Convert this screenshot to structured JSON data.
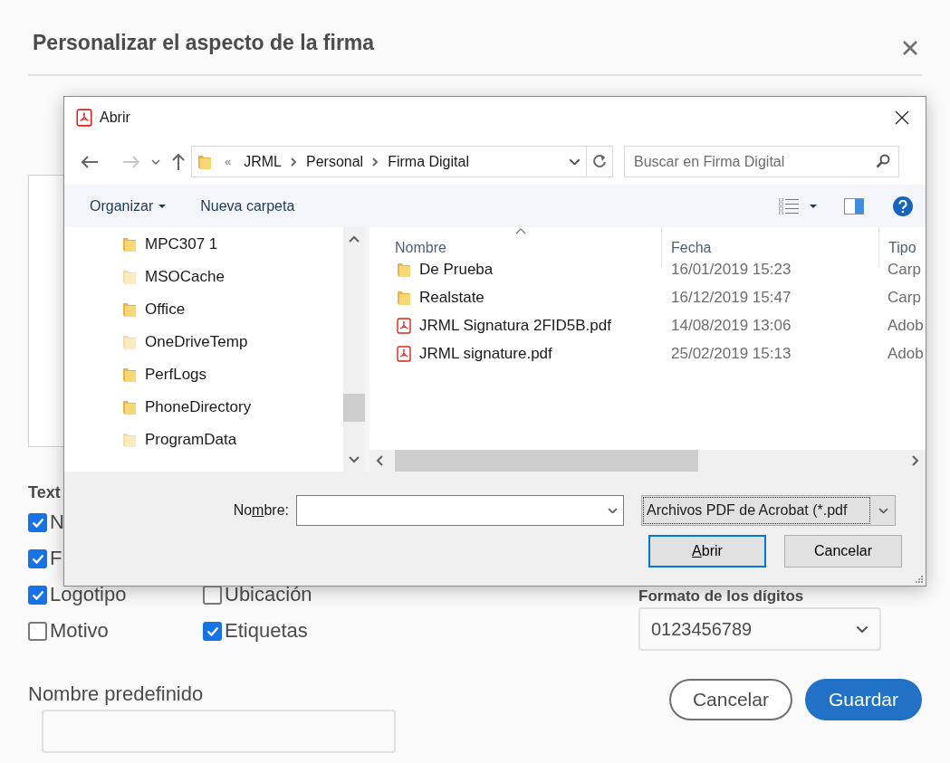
{
  "signature_dialog": {
    "title": "Personalizar el aspecto de la firma",
    "text_section": {
      "heading": "Text",
      "rows": [
        {
          "options": [
            {
              "label": "N",
              "checked": true
            }
          ]
        },
        {
          "options": [
            {
              "label": "F",
              "checked": true
            }
          ]
        },
        {
          "options": [
            {
              "label": "Logotipo",
              "checked": true
            },
            {
              "label": "Ubicación",
              "checked": false
            }
          ]
        },
        {
          "options": [
            {
              "label": "Motivo",
              "checked": false
            },
            {
              "label": "Etiquetas",
              "checked": true
            }
          ]
        }
      ]
    },
    "digits_format": {
      "label": "Formato de los dígitos",
      "value": "0123456789"
    },
    "default_name": {
      "label": "Nombre predefinido"
    },
    "buttons": [
      {
        "label": "Cancelar",
        "kind": "secondary"
      },
      {
        "label": "Guardar",
        "kind": "primary"
      }
    ]
  },
  "open_dialog": {
    "title": "Abrir",
    "breadcrumb": {
      "overflow": "«",
      "segments": [
        "JRML",
        "Personal",
        "Firma Digital"
      ]
    },
    "search": {
      "placeholder": "Buscar en Firma Digital"
    },
    "toolbar": [
      {
        "label": "Organizar",
        "dropdown": true
      },
      {
        "label": "Nueva carpeta",
        "dropdown": false
      }
    ],
    "tree": [
      {
        "name": "MPC307 1",
        "hidden": false
      },
      {
        "name": "MSOCache",
        "hidden": true
      },
      {
        "name": "Office",
        "hidden": false
      },
      {
        "name": "OneDriveTemp",
        "hidden": true
      },
      {
        "name": "PerfLogs",
        "hidden": false
      },
      {
        "name": "PhoneDirectory",
        "hidden": false
      },
      {
        "name": "ProgramData",
        "hidden": true
      }
    ],
    "columns": [
      {
        "label": "Nombre",
        "sorted": true
      },
      {
        "label": "Fecha",
        "sorted": false
      },
      {
        "label": "Tipo",
        "sorted": false
      }
    ],
    "files": [
      {
        "name": "De Prueba",
        "kind": "folder",
        "date": "16/01/2019 15:23",
        "type": "Carp"
      },
      {
        "name": "Realstate",
        "kind": "folder",
        "date": "16/12/2019 15:47",
        "type": "Carp"
      },
      {
        "name": "JRML Signatura 2FID5B.pdf",
        "kind": "pdf",
        "date": "14/08/2019 13:06",
        "type": "Adob"
      },
      {
        "name": "JRML signature.pdf",
        "kind": "pdf",
        "date": "25/02/2019 15:13",
        "type": "Adob"
      }
    ],
    "filename": {
      "label": {
        "before": "No",
        "key": "m",
        "after": "bre:"
      }
    },
    "filter": "Archivos PDF de Acrobat (*.pdf",
    "buttons": [
      {
        "label": {
          "key": "A",
          "after": "brir"
        },
        "default": true
      },
      {
        "label": {
          "before": "Cancelar"
        },
        "default": false
      }
    ]
  }
}
